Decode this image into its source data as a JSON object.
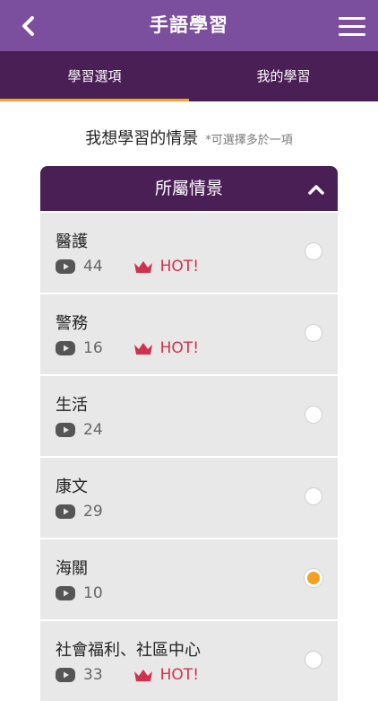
{
  "appbar": {
    "title": "手語學習"
  },
  "tabs": [
    {
      "label": "學習選項",
      "active": true
    },
    {
      "label": "我的學習",
      "active": false
    }
  ],
  "heading": {
    "title": "我想學習的情景",
    "note": "*可選擇多於一項"
  },
  "section": {
    "title": "所屬情景"
  },
  "items": [
    {
      "name": "醫護",
      "count": "44",
      "hot": "HOT!",
      "checked": false
    },
    {
      "name": "警務",
      "count": "16",
      "hot": "HOT!",
      "checked": false
    },
    {
      "name": "生活",
      "count": "24",
      "hot": "",
      "checked": false
    },
    {
      "name": "康文",
      "count": "29",
      "hot": "",
      "checked": false
    },
    {
      "name": "海關",
      "count": "10",
      "hot": "",
      "checked": true
    },
    {
      "name": "社會福利、社區中心",
      "count": "33",
      "hot": "HOT!",
      "checked": false
    }
  ],
  "colors": {
    "appbar": "#7b4e9e",
    "tabbar": "#4a1f55",
    "accent": "#f5a020",
    "hot": "#d0324d"
  },
  "icons": {
    "back": "chevron-left-icon",
    "menu": "hamburger-menu-icon",
    "collapse": "chevron-up-icon",
    "video": "play-icon",
    "hot": "crown-icon"
  }
}
